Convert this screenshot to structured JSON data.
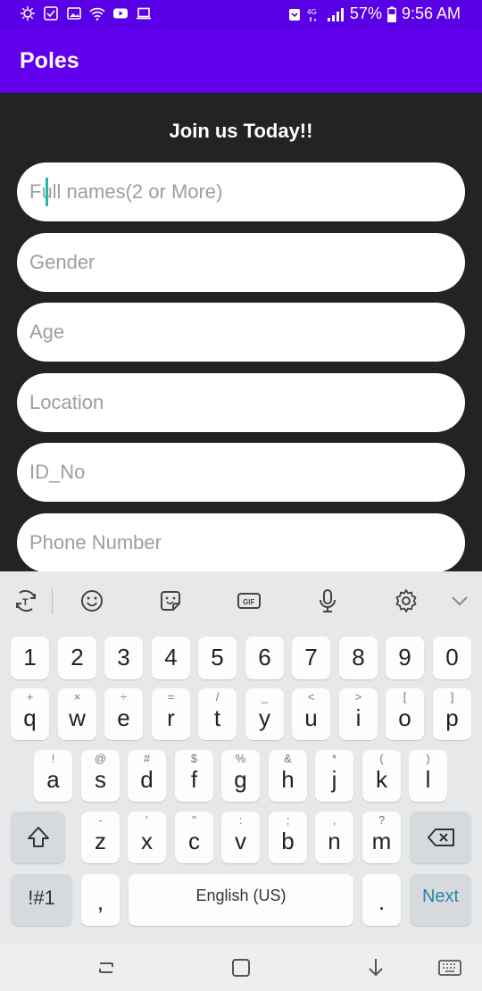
{
  "status_bar": {
    "battery_percent": "57%",
    "time": "9:56 AM",
    "network": "4G"
  },
  "app": {
    "title": "Poles"
  },
  "form": {
    "heading": "Join us Today!!",
    "fields": [
      {
        "placeholder": "Full names(2 or More)",
        "value": ""
      },
      {
        "placeholder": "Gender",
        "value": ""
      },
      {
        "placeholder": "Age",
        "value": ""
      },
      {
        "placeholder": "Location",
        "value": ""
      },
      {
        "placeholder": "ID_No",
        "value": ""
      },
      {
        "placeholder": "Phone Number",
        "value": ""
      }
    ]
  },
  "keyboard": {
    "number_row": [
      "1",
      "2",
      "3",
      "4",
      "5",
      "6",
      "7",
      "8",
      "9",
      "0"
    ],
    "row1": [
      {
        "k": "q",
        "h": "+"
      },
      {
        "k": "w",
        "h": "×"
      },
      {
        "k": "e",
        "h": "÷"
      },
      {
        "k": "r",
        "h": "="
      },
      {
        "k": "t",
        "h": "/"
      },
      {
        "k": "y",
        "h": "_"
      },
      {
        "k": "u",
        "h": "<"
      },
      {
        "k": "i",
        "h": ">"
      },
      {
        "k": "o",
        "h": "["
      },
      {
        "k": "p",
        "h": "]"
      }
    ],
    "row2": [
      {
        "k": "a",
        "h": "!"
      },
      {
        "k": "s",
        "h": "@"
      },
      {
        "k": "d",
        "h": "#"
      },
      {
        "k": "f",
        "h": "$"
      },
      {
        "k": "g",
        "h": "%"
      },
      {
        "k": "h",
        "h": "&"
      },
      {
        "k": "j",
        "h": "*"
      },
      {
        "k": "k",
        "h": "("
      },
      {
        "k": "l",
        "h": ")"
      }
    ],
    "row3": [
      {
        "k": "z",
        "h": "-"
      },
      {
        "k": "x",
        "h": "'"
      },
      {
        "k": "c",
        "h": "\""
      },
      {
        "k": "v",
        "h": ":"
      },
      {
        "k": "b",
        "h": ";"
      },
      {
        "k": "n",
        "h": ","
      },
      {
        "k": "m",
        "h": "?"
      }
    ],
    "symbols_label": "!#1",
    "comma": ",",
    "space_label": "English (US)",
    "period": ".",
    "action_label": "Next",
    "action_color": "#2a86a8"
  },
  "colors": {
    "status_bar": "#5a00e6",
    "app_bar": "#6200ee",
    "background": "#232323",
    "caret": "#20b7b3"
  }
}
